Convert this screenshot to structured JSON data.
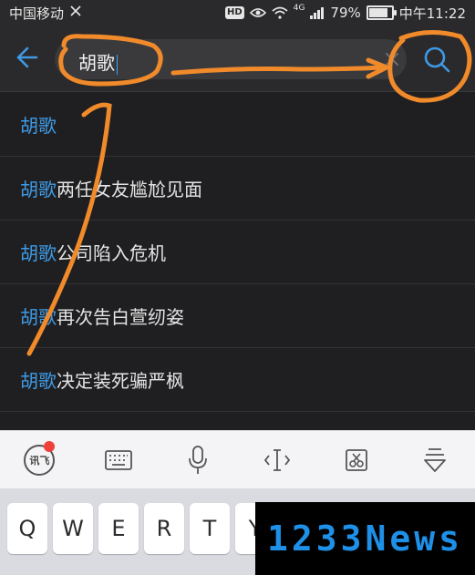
{
  "status_bar": {
    "carrier": "中国移动",
    "carrier_icon": "hd-voice-icon",
    "hd_badge": "HD",
    "network": "4G",
    "battery": "79%",
    "battery_level": 0.79,
    "time": "中午11:22"
  },
  "search": {
    "value": "胡歌",
    "icons": {
      "back": "back-arrow-icon",
      "clear": "close-icon",
      "submit": "search-icon"
    }
  },
  "suggestions": [
    {
      "highlight": "胡歌",
      "rest": ""
    },
    {
      "highlight": "胡歌",
      "rest": "两任女友尴尬见面"
    },
    {
      "highlight": "胡歌",
      "rest": "公司陷入危机"
    },
    {
      "highlight": "胡歌",
      "rest": "再次告白萱纫姿"
    },
    {
      "highlight": "胡歌",
      "rest": "决定装死骗严枫"
    }
  ],
  "keyboard_toolbar": {
    "logo_text": "讯飞",
    "tools": [
      "iflytek-logo-icon",
      "keyboard-icon",
      "microphone-icon",
      "cursor-move-icon",
      "clipboard-icon",
      "collapse-keyboard-icon"
    ]
  },
  "keyboard": {
    "visible_keys": [
      "Q",
      "W",
      "E",
      "R",
      "T",
      "Y"
    ]
  },
  "watermark": {
    "text": "1233News"
  },
  "colors": {
    "accent": "#3f9ae4",
    "annotation": "#f08a2a",
    "background": "#1f1f21"
  }
}
